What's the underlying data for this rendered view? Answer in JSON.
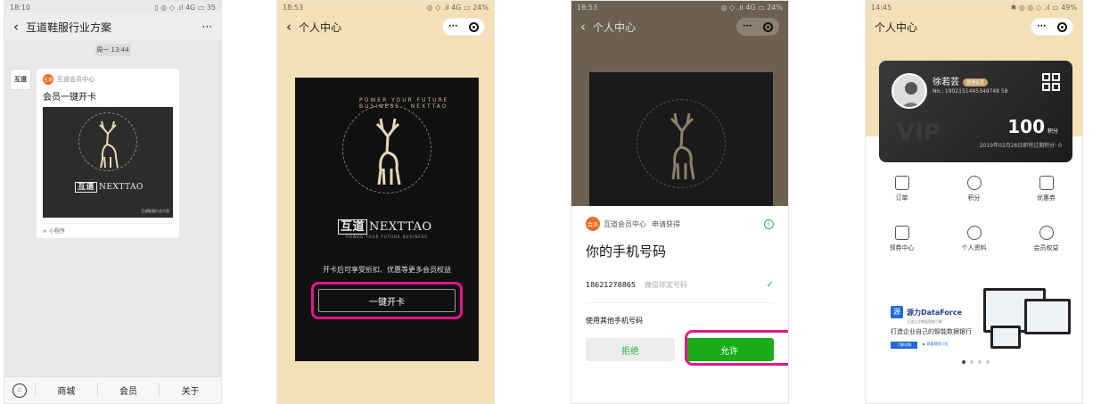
{
  "phone1": {
    "status_time": "18:10",
    "status_right": "▯ ◎ ◇ .ıl 4G ▭ 35",
    "nav_title": "互道鞋服行业方案",
    "more": "···",
    "timestamp": "周一 13:44",
    "card": {
      "avatar_text": "互道",
      "source_badge": "互道",
      "source": "互道会员中心",
      "title": "会员一键开卡",
      "image_brand": "NEXTTAO",
      "image_logo_cn": "互道",
      "image_caption": "互道鞋服行业方案",
      "footer": "小程序"
    },
    "tabbar": [
      "商城",
      "会员",
      "关于"
    ],
    "keyboard_icon": "::"
  },
  "phone2": {
    "status_time": "18:53",
    "status_right": "◎ ◇ .ıl 4G ▭ 24%",
    "nav_title": "个人中心",
    "capsule_more": "···",
    "brand_cn": "互道",
    "brand": "NEXTTAO",
    "brand_slogan": "POWER YOUR FUTURE BUSINESS",
    "ring_text": "POWER YOUR FUTURE BUSINESS · NEXTTAO",
    "hint": "开卡后可享受折扣、优惠等更多会员权益",
    "button": "一键开卡"
  },
  "phone3": {
    "status_time": "18:53",
    "status_right": "◎ ◇ .ıl 4G ▭ 24%",
    "nav_title": "个人中心",
    "capsule_more": "···",
    "badge": "会员",
    "app_name": "互道会员中心",
    "request": "申请获得",
    "info": "i",
    "sheet_title": "你的手机号码",
    "phone": "18621278865",
    "phone_sub": "微信绑定号码",
    "check": "✓",
    "other": "使用其他手机号码",
    "deny": "拒绝",
    "allow": "允许"
  },
  "phone4": {
    "status_time": "14:45",
    "status_right": "✱ ◎ ◎ ◇ .ıl ▭ 49%",
    "nav_title": "个人中心",
    "capsule_more": "···",
    "card": {
      "name": "徐若芸",
      "level": "普通会员",
      "no": "No.: 1902151445349748 58",
      "points": "100",
      "points_unit": "积分",
      "expire": "2019年02月28日即将过期积分: 0",
      "watermark": "VIP"
    },
    "grid": [
      "订单",
      "积分",
      "优惠券",
      "领券中心",
      "个人资料",
      "会员权益"
    ],
    "banner": {
      "logo_char": "源",
      "name": "源力DataForce",
      "sub": "互道企业数据智能引擎",
      "tagline": "打造企业自己的智能数据银行",
      "btn1": "了解详情",
      "btn2": "▶ 观看视频介绍"
    }
  },
  "colors": {
    "accent_pink": "#e0188a",
    "wechat_green": "#1aad19",
    "gold_bg": "#f4e0b6"
  }
}
